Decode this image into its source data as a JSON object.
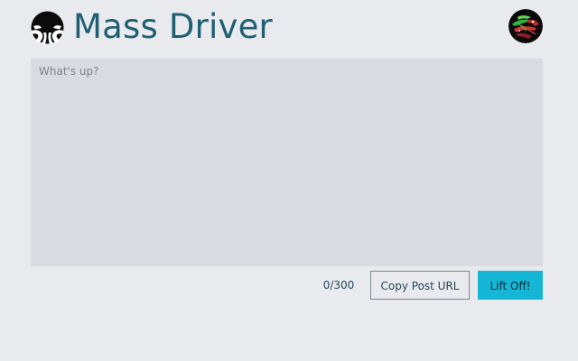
{
  "app": {
    "title": "Mass Driver",
    "logo_icon": "mass-driver-logo-icon",
    "avatar_icon": "user-avatar"
  },
  "composer": {
    "placeholder": "What's up?",
    "value": ""
  },
  "footer": {
    "char_count": "0/300",
    "copy_url_label": "Copy Post URL",
    "submit_label": "Lift Off!"
  },
  "colors": {
    "background": "#e8eaed",
    "title": "#1e5f73",
    "composer_bg": "#d8dbe2",
    "accent": "#16b6d6",
    "button_border": "#7d8791"
  }
}
